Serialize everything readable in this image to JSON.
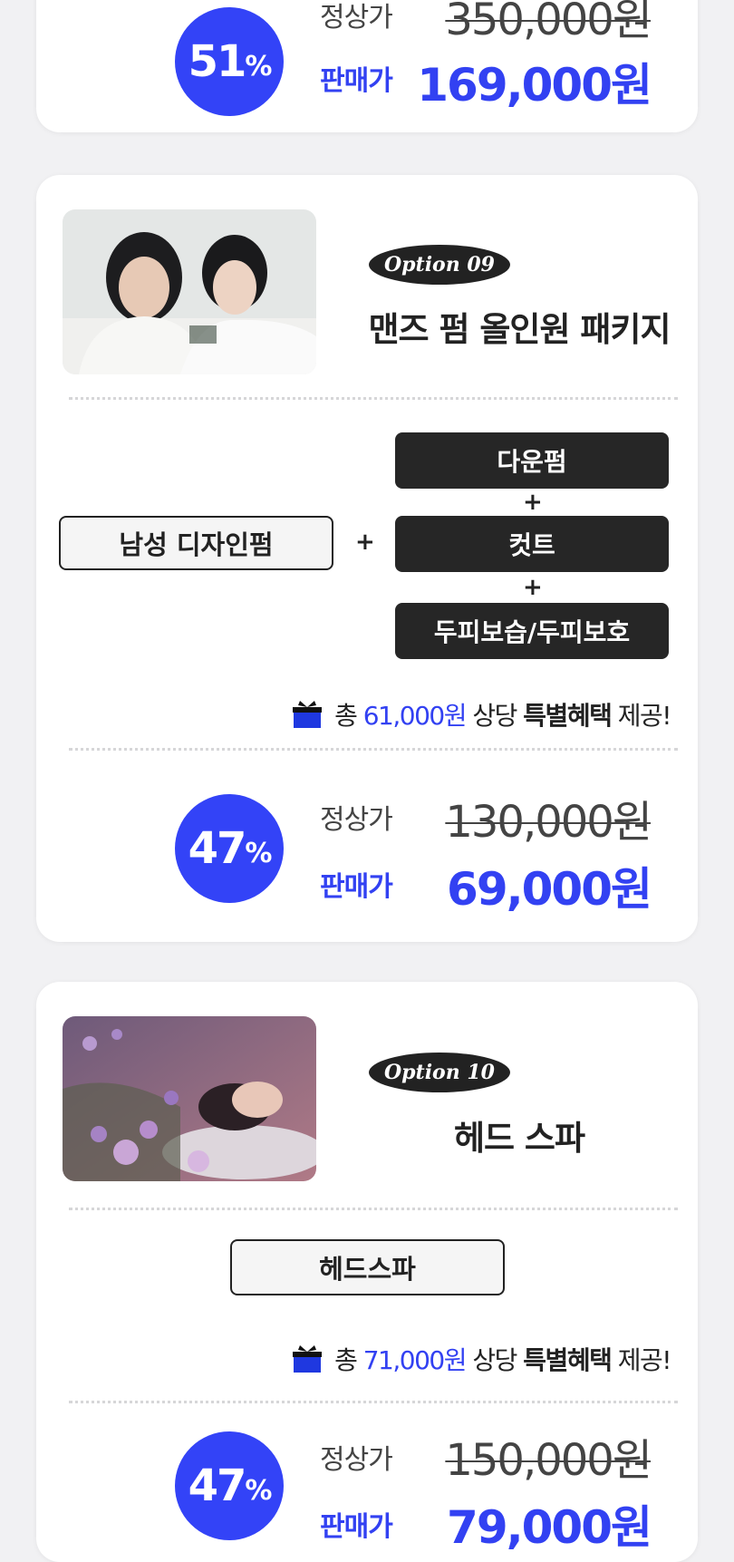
{
  "colors": {
    "accent": "#3241f2",
    "badge_bg": "#3343f7",
    "dark": "#262626",
    "page_bg": "#f1f1f3"
  },
  "option8_partial": {
    "discount_num": "51",
    "discount_pct": "%",
    "regular_label": "정상가",
    "regular_price": "350,000원",
    "sale_label": "판매가",
    "sale_price": "169,000원"
  },
  "option9": {
    "badge": "Option 09",
    "title": "맨즈 펌 올인원 패키지",
    "image_icon": "two-men-photo",
    "main_item": "남성 디자인펌",
    "plus": "+",
    "items": [
      "다운펌",
      "컷트",
      "두피보습/두피보호"
    ],
    "benefit": {
      "icon": "gift-icon",
      "prefix": "총 ",
      "amount": "61,000원",
      "mid": " 상당 ",
      "bold": "특별혜택",
      "suffix": " 제공!"
    },
    "discount_num": "47",
    "discount_pct": "%",
    "regular_label": "정상가",
    "regular_price": "130,000원",
    "sale_label": "판매가",
    "sale_price": "69,000원"
  },
  "option10": {
    "badge": "Option 10",
    "title": "헤드 스파",
    "image_icon": "head-spa-photo",
    "main_item": "헤드스파",
    "benefit": {
      "icon": "gift-icon",
      "prefix": "총 ",
      "amount": "71,000원",
      "mid": " 상당 ",
      "bold": "특별혜택",
      "suffix": " 제공!"
    },
    "discount_num": "47",
    "discount_pct": "%",
    "regular_label": "정상가",
    "regular_price": "150,000원",
    "sale_label": "판매가",
    "sale_price": "79,000원"
  }
}
